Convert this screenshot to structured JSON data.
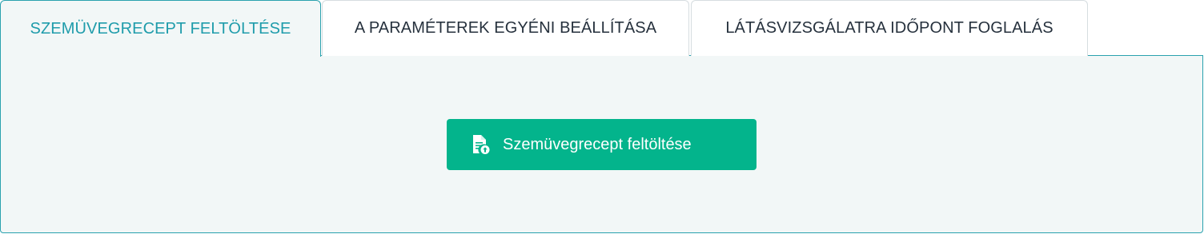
{
  "tabs": [
    {
      "label": "SZEMÜVEGRECEPT FELTÖLTÉSE",
      "active": true
    },
    {
      "label": "A PARAMÉTEREK EGYÉNI BEÁLLÍTÁSA",
      "active": false
    },
    {
      "label": "LÁTÁSVIZSGÁLATRA IDŐPONT FOGLALÁS",
      "active": false
    }
  ],
  "panel": {
    "upload_button": {
      "label": "Szemüvegrecept feltöltése",
      "icon": "document-upload-icon"
    }
  },
  "colors": {
    "accent": "#1f9cab",
    "button": "#03b48c",
    "panel_bg": "#f2f7f7"
  }
}
